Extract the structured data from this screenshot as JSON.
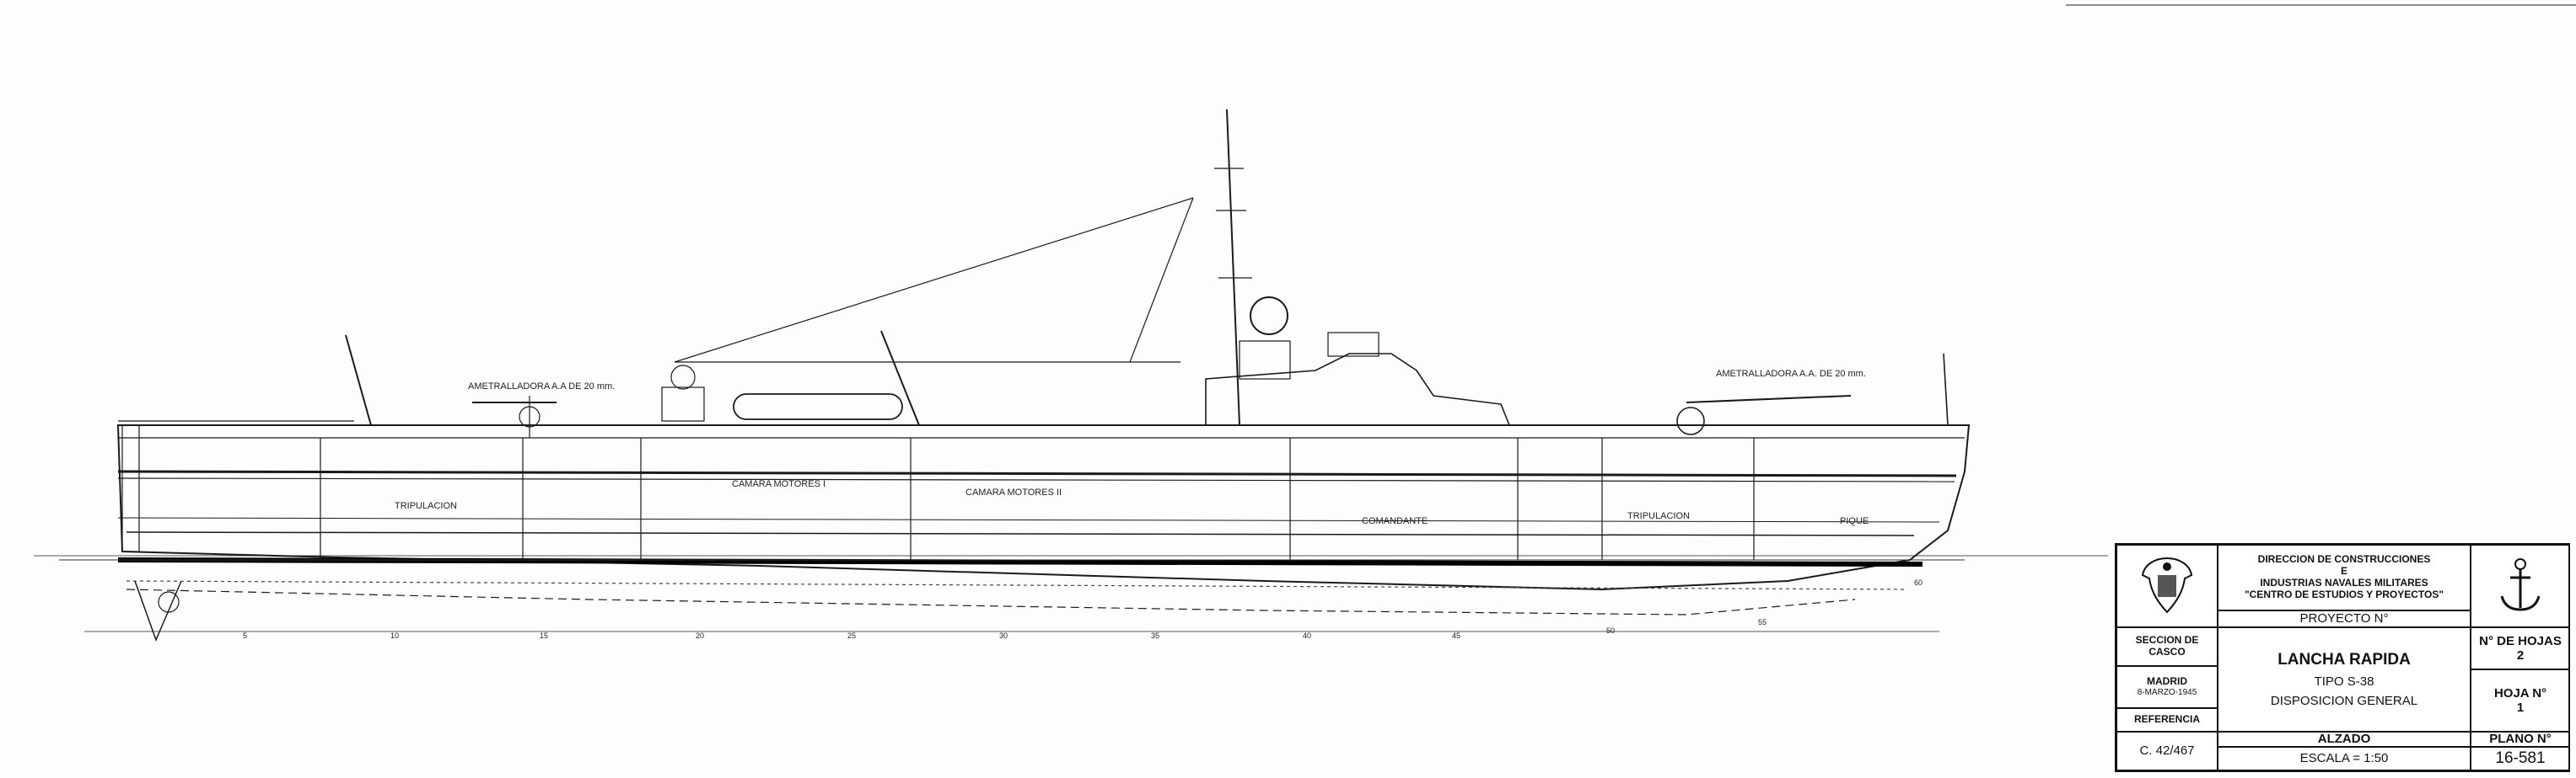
{
  "annotations": {
    "gun_aft": "AMETRALLADORA A.A DE 20 mm.",
    "gun_fwd": "AMETRALLADORA A.A. DE 20 mm.",
    "compartments": {
      "tripulacion_aft": "TRIPULACION",
      "camara_motores_1": "CAMARA MOTORES I",
      "camara_motores_2": "CAMARA MOTORES II",
      "comandante": "COMANDANTE",
      "tripulacion_fwd": "TRIPULACION",
      "pique": "PIQUE"
    },
    "frames": [
      "5",
      "10",
      "15",
      "20",
      "25",
      "30",
      "35",
      "40",
      "45",
      "50",
      "55",
      "60"
    ]
  },
  "title_block": {
    "organization": {
      "line1": "DIRECCION DE CONSTRUCCIONES",
      "line2": "E",
      "line3": "INDUSTRIAS NAVALES MILITARES",
      "line4": "\"CENTRO DE ESTUDIOS Y PROYECTOS\""
    },
    "proyecto": "PROYECTO N°",
    "seccion": "SECCION DE CASCO",
    "lugar": "MADRID",
    "fecha": "8-MARZO-1945",
    "referencia_label": "REFERENCIA",
    "referencia_value": "C. 42/467",
    "vessel": "LANCHA RAPIDA",
    "tipo": "TIPO S-38",
    "disposicion": "DISPOSICION GENERAL",
    "vista": "ALZADO",
    "escala": "ESCALA = 1:50",
    "hojas_label": "N° DE HOJAS",
    "hojas_value": "2",
    "hoja_label": "HOJA N°",
    "hoja_value": "1",
    "plano_label": "PLANO N°",
    "plano_value": "16-581"
  }
}
